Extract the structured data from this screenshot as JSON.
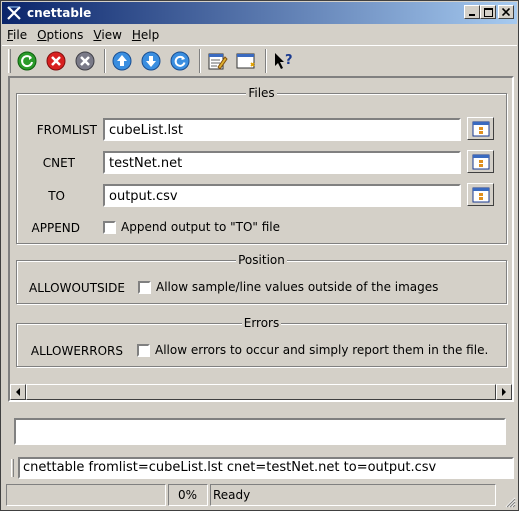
{
  "window": {
    "title": "cnettable"
  },
  "menu": [
    {
      "label": "File",
      "mnemonic": "F"
    },
    {
      "label": "Options",
      "mnemonic": "O"
    },
    {
      "label": "View",
      "mnemonic": "V"
    },
    {
      "label": "Help",
      "mnemonic": "H"
    }
  ],
  "toolbar": {
    "icons": [
      "run-icon",
      "stop-icon",
      "reset-icon",
      "previous-icon",
      "next-icon",
      "refresh-icon",
      "edit-log-icon",
      "window-icon",
      "whats-this-icon"
    ]
  },
  "files": {
    "title": "Files",
    "fromlist": {
      "label": "FROMLIST",
      "value": "cubeList.lst"
    },
    "cnet": {
      "label": "CNET",
      "value": "testNet.net"
    },
    "to": {
      "label": "TO",
      "value": "output.csv"
    },
    "append": {
      "label": "APPEND",
      "checkbox_label": "Append output to \"TO\" file",
      "checked": false
    }
  },
  "position": {
    "title": "Position",
    "allowoutside": {
      "label": "ALLOWOUTSIDE",
      "checkbox_label": "Allow sample/line values outside of the images",
      "checked": false
    }
  },
  "errors": {
    "title": "Errors",
    "allowerrors": {
      "label": "ALLOWERRORS",
      "checkbox_label": "Allow errors to occur and simply report them in the file.",
      "checked": false
    }
  },
  "command_line": "cnettable fromlist=cubeList.lst cnet=testNet.net to=output.csv",
  "status": {
    "progress": "0%",
    "message": "Ready"
  },
  "colors": {
    "titlebar_start": "#0a246a",
    "titlebar_end": "#a6caf0",
    "face": "#d4d0c8"
  }
}
